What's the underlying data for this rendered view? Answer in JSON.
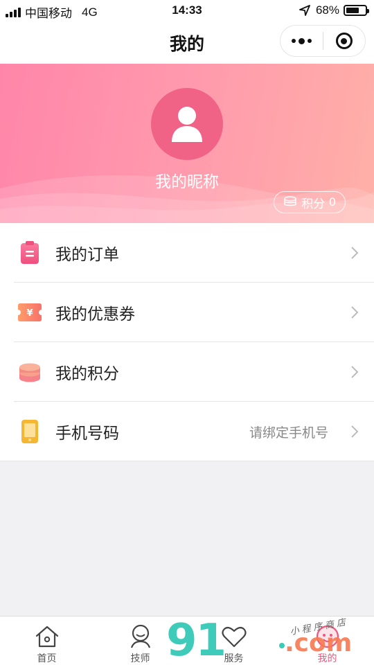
{
  "status_bar": {
    "carrier": "中国移动",
    "network": "4G",
    "time": "14:33",
    "battery_percent": "68%",
    "battery_level": 0.68
  },
  "nav": {
    "title": "我的",
    "more_icon": "more-dots-icon",
    "close_icon": "target-circle-icon"
  },
  "profile": {
    "nickname": "我的昵称",
    "points_label": "积分",
    "points_value": "0",
    "avatar_icon": "user-avatar-icon"
  },
  "menu": {
    "items": [
      {
        "label": "我的订单",
        "value": "",
        "icon": "clipboard-icon",
        "color": "#f4618a"
      },
      {
        "label": "我的优惠券",
        "value": "",
        "icon": "coupon-icon",
        "color": "#fb8a6a"
      },
      {
        "label": "我的积分",
        "value": "",
        "icon": "coin-stack-icon",
        "color": "#f47a78"
      },
      {
        "label": "手机号码",
        "value": "请绑定手机号",
        "icon": "phone-icon",
        "color": "#f5b731"
      }
    ]
  },
  "tabs": [
    {
      "label": "首页",
      "icon": "home-icon",
      "active": false
    },
    {
      "label": "技师",
      "icon": "technician-icon",
      "active": false
    },
    {
      "label": "服务",
      "icon": "heart-icon",
      "active": false
    },
    {
      "label": "我的",
      "icon": "profile-icon",
      "active": true
    }
  ],
  "watermark": {
    "brand": "91",
    "tld": ".com",
    "small_text": "小程序商店"
  },
  "colors": {
    "accent": "#f2547f",
    "banner_start": "#ff86a9",
    "banner_end": "#ffb0a8",
    "page_background": "#f1f1f4"
  }
}
